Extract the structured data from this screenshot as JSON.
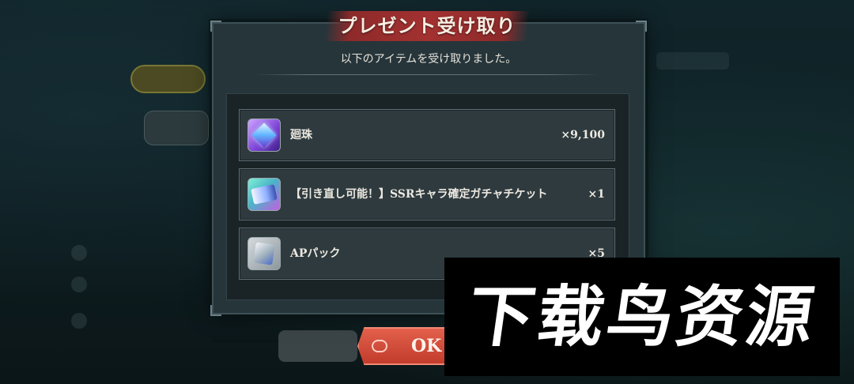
{
  "dialog": {
    "title": "プレゼント受け取り",
    "message": "以下のアイテムを受け取りました。"
  },
  "items": [
    {
      "name": "廻珠",
      "quantity": "×9,100",
      "icon": "orb-crystal-icon"
    },
    {
      "name": "【引き直し可能！】SSRキャラ確定ガチャチケット",
      "quantity": "×1",
      "icon": "gacha-ticket-icon"
    },
    {
      "name": "APパック",
      "quantity": "×5",
      "icon": "ap-pack-icon"
    }
  ],
  "ok_button": {
    "label": "OK"
  },
  "watermark": {
    "text": "下载鸟资源"
  },
  "colors": {
    "accent": "#a33131",
    "ok_button": "#d14a36",
    "dialog_bg": "#26353a"
  }
}
